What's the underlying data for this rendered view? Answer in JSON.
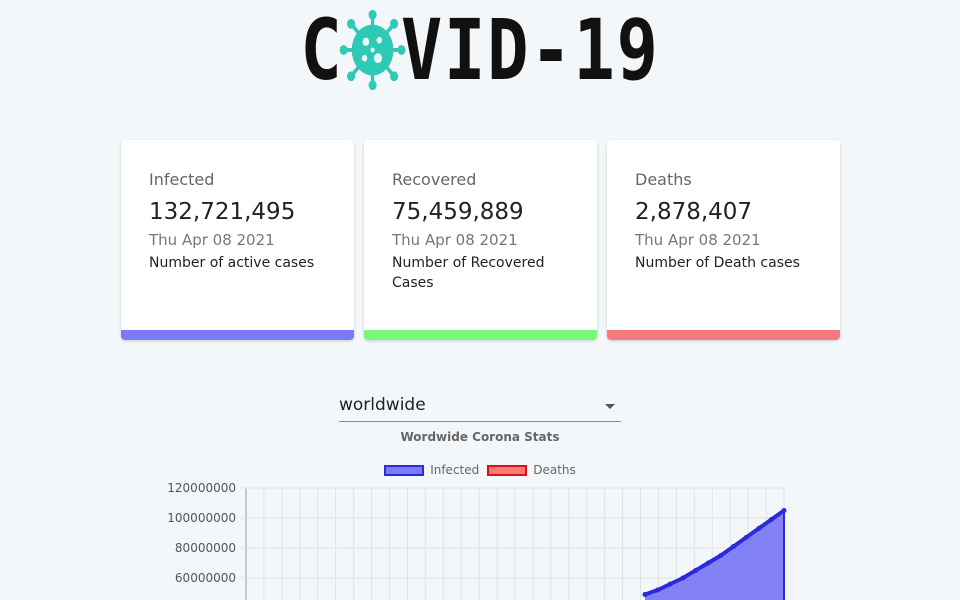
{
  "logo": {
    "text_before": "C",
    "text_after": "VID-19"
  },
  "cards": [
    {
      "title": "Infected",
      "count": "132,721,495",
      "date": "Thu Apr 08 2021",
      "desc": "Number of active cases",
      "color": "#7b7bf5"
    },
    {
      "title": "Recovered",
      "count": "75,459,889",
      "date": "Thu Apr 08 2021",
      "desc": "Number of Recovered Cases",
      "color": "#7cf57c"
    },
    {
      "title": "Deaths",
      "count": "2,878,407",
      "date": "Thu Apr 08 2021",
      "desc": "Number of Death cases",
      "color": "#f57b7b"
    }
  ],
  "country_select": {
    "value": "worldwide"
  },
  "chart_data": {
    "type": "line",
    "title": "Wordwide Corona Stats",
    "legend": [
      {
        "name": "Infected",
        "fill": "#7b7bf5",
        "stroke": "#2b2bdc"
      },
      {
        "name": "Deaths",
        "fill": "#f57b7b",
        "stroke": "#e01010"
      }
    ],
    "y_ticks": [
      60000000,
      80000000,
      100000000,
      120000000
    ],
    "ylim": [
      0,
      120000000
    ],
    "grid": true,
    "series": [
      {
        "name": "Infected",
        "values": [
          49000000,
          52000000,
          56000000,
          60000000,
          65000000,
          70000000,
          75000000,
          81000000,
          87000000,
          93000000,
          99000000,
          105000000
        ]
      }
    ]
  }
}
